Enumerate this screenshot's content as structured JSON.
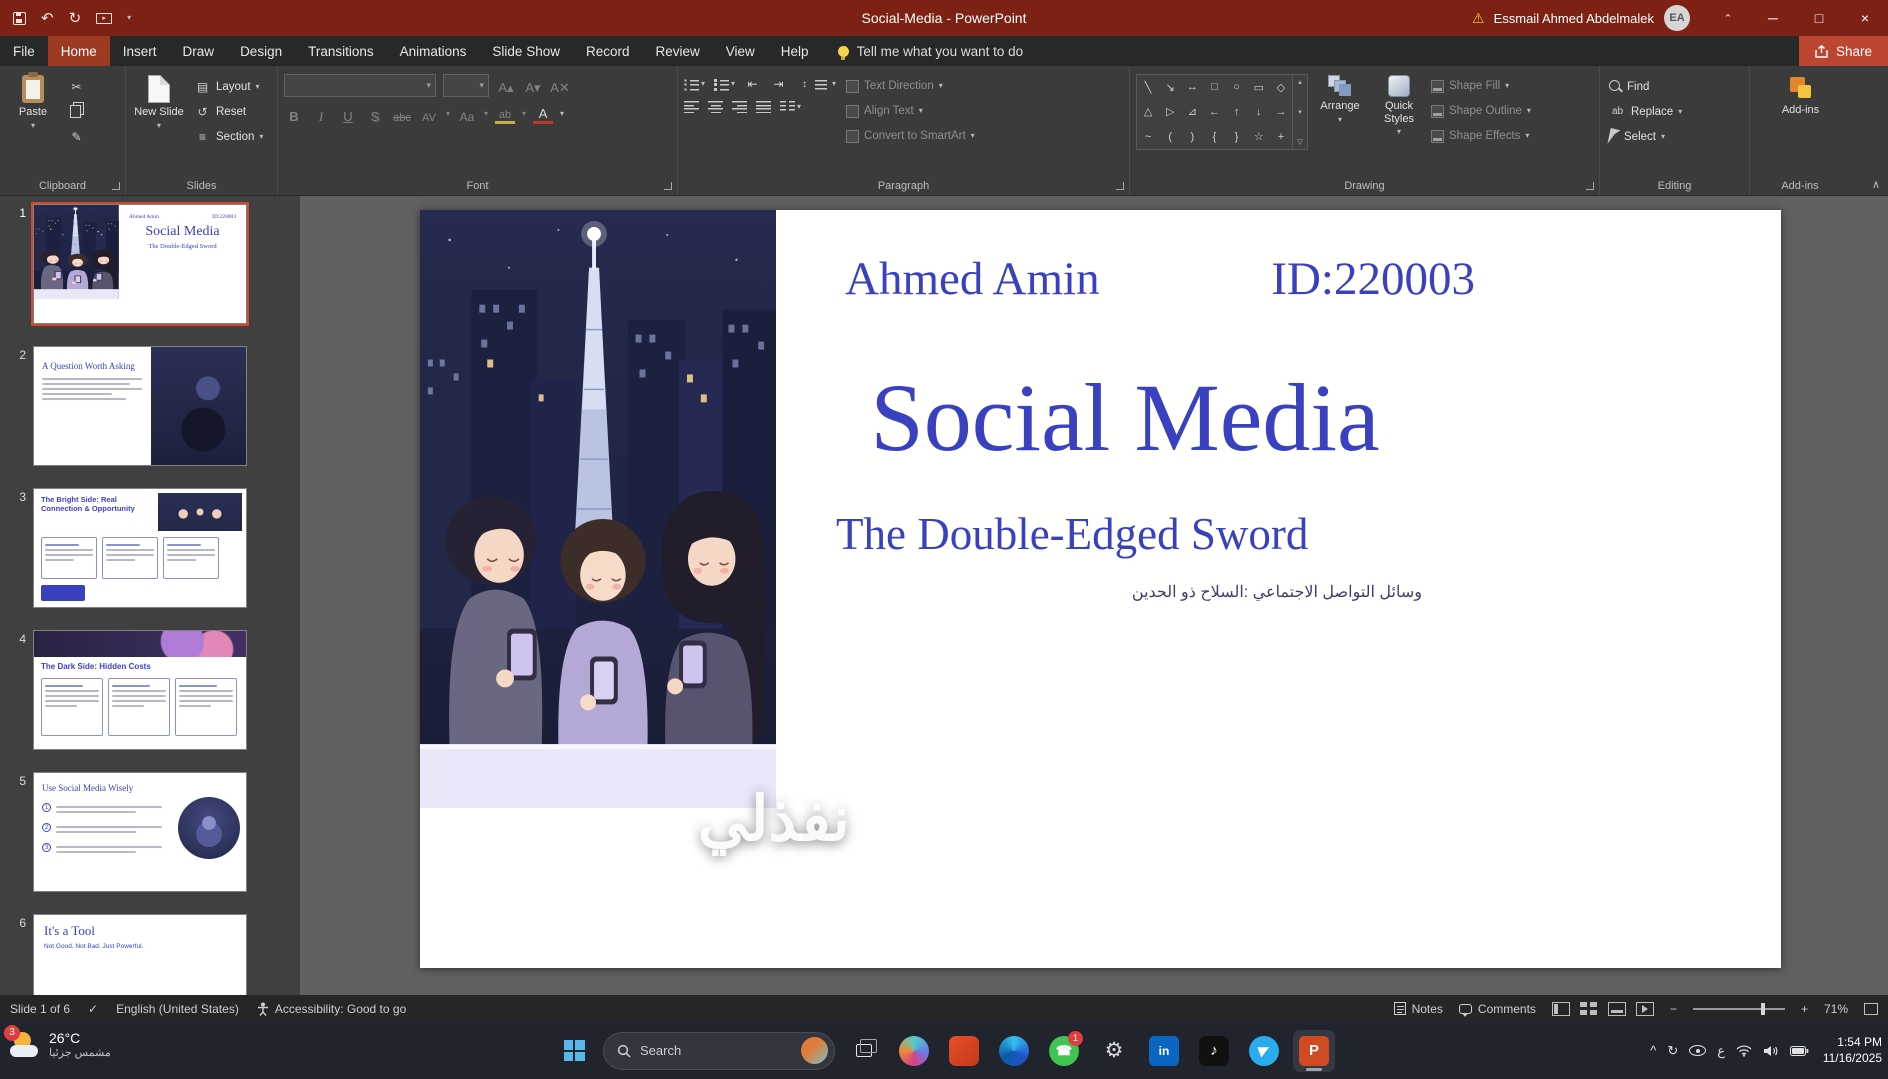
{
  "colors": {
    "titlebar_red": "#7c2114",
    "active_tab_red": "#9c3a22",
    "share_red": "#bc4631",
    "ribbon_gray": "#3b3b3b",
    "slide_accent_blue": "#3a41c1",
    "selection_orange": "#d0492f",
    "powerpoint_orange": "#d04a22",
    "whatsapp_green": "#41c452",
    "telegram_blue": "#2aabee",
    "linkedin_blue": "#0a66c2",
    "warning_yellow": "#f3c43f"
  },
  "titlebar": {
    "title": "Social-Media - PowerPoint",
    "user_name": "Essmail Ahmed Abdelmalek",
    "avatar_initials": "EA"
  },
  "tabs": {
    "file": "File",
    "home": "Home",
    "insert": "Insert",
    "draw": "Draw",
    "design": "Design",
    "transitions": "Transitions",
    "animations": "Animations",
    "slide_show": "Slide Show",
    "record": "Record",
    "review": "Review",
    "view": "View",
    "help": "Help",
    "tellme": "Tell me what you want to do",
    "share": "Share"
  },
  "ribbon": {
    "clipboard": {
      "group": "Clipboard",
      "paste": "Paste"
    },
    "slides": {
      "group": "Slides",
      "new_slide": "New Slide",
      "layout": "Layout",
      "reset": "Reset",
      "section": "Section"
    },
    "font": {
      "group": "Font",
      "bold": "B",
      "italic": "I",
      "underline": "U",
      "shadow": "S",
      "strike": "abc",
      "spacing": "AV",
      "case": "Aa",
      "highlight": "ab",
      "color": "A"
    },
    "paragraph": {
      "group": "Paragraph",
      "text_direction": "Text Direction",
      "align_text": "Align Text",
      "smartart": "Convert to SmartArt"
    },
    "drawing": {
      "group": "Drawing",
      "arrange": "Arrange",
      "quick_styles": "Quick Styles",
      "fill": "Shape Fill",
      "outline": "Shape Outline",
      "effects": "Shape Effects"
    },
    "editing": {
      "group": "Editing",
      "find": "Find",
      "replace": "Replace",
      "select": "Select"
    },
    "addins": {
      "group": "Add-ins",
      "button": "Add-ins"
    }
  },
  "thumbnails": {
    "t1": {
      "num": "1",
      "author": "Ahmed Amin",
      "sid": "ID:220003",
      "title": "Social Media",
      "subtitle": "The Double-Edged Sword"
    },
    "t2": {
      "num": "2",
      "title": "A Question Worth Asking"
    },
    "t3": {
      "num": "3",
      "title": "The Bright Side: Real Connection & Opportunity"
    },
    "t4": {
      "num": "4",
      "title": "The Dark Side: Hidden Costs"
    },
    "t5": {
      "num": "5",
      "title": "Use Social Media Wisely",
      "n1": "1",
      "n2": "2",
      "n3": "3"
    },
    "t6": {
      "num": "6",
      "title": "It's a Tool",
      "subtitle": "Not Good. Not Bad. Just Powerful."
    }
  },
  "slide": {
    "author": "Ahmed Amin",
    "student_id": "ID:220003",
    "title": "Social Media",
    "subtitle": "The Double-Edged Sword",
    "arabic_caption": "وسائل التواصل الاجتماعي :السلاح ذو الحدين"
  },
  "watermark": {
    "text": "نفذلي"
  },
  "statusbar": {
    "slide_counter": "Slide 1 of 6",
    "language": "English (United States)",
    "accessibility": "Accessibility: Good to go",
    "notes": "Notes",
    "comments": "Comments",
    "zoom_level": "71%"
  },
  "taskbar": {
    "weather_badge": "3",
    "temperature": "26°C",
    "weather_desc": "مشمس جزئيا",
    "search_label": "Search",
    "whatsapp_badge": "1",
    "language_indicator": "ع",
    "time": "1:54 PM",
    "date": "11/16/2025"
  }
}
